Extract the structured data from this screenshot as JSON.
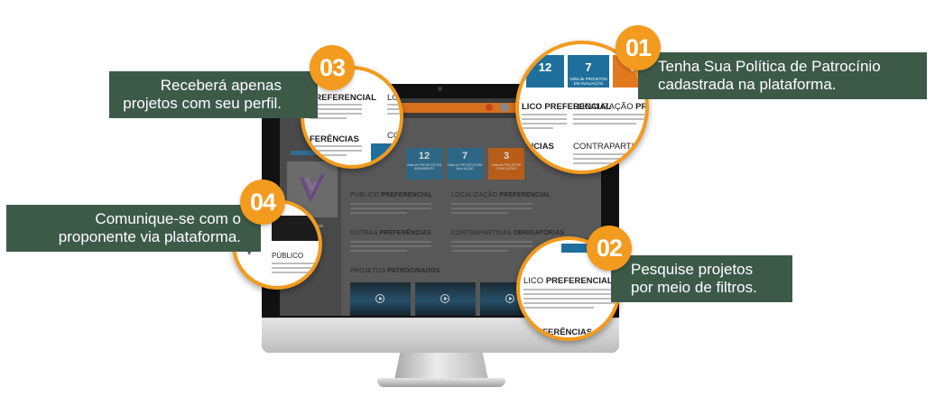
{
  "callouts": {
    "c01": {
      "number": "01",
      "line1": "Tenha Sua Política de Patrocínio",
      "line2": "cadastrada na plataforma."
    },
    "c02": {
      "number": "02",
      "line1": "Pesquise projetos",
      "line2": "por meio de filtros."
    },
    "c03": {
      "number": "03",
      "line1": "Receberá apenas",
      "line2": "projetos com seu perfil."
    },
    "c04": {
      "number": "04",
      "line1": "Comunique-se com o",
      "line2": "proponente via plataforma."
    }
  },
  "screen": {
    "stats": [
      {
        "value": "12",
        "label": "Volta de PROJETOS EM ANDAMENTO"
      },
      {
        "value": "7",
        "label": "Volta de PROJETOS EM AVALIAÇÃO"
      },
      {
        "value": "3",
        "label": "Volta de PROJETOS CONCLUÍDOS"
      }
    ],
    "sections": {
      "publico": {
        "light": "PÚBLICO ",
        "bold": "PREFERENCIAL"
      },
      "localizacao": {
        "light": "LOCALIZAÇÃO ",
        "bold": "PREFERENCIAL"
      },
      "outras": {
        "light": "OUTRAS ",
        "bold": "PREFERÊNCIAS"
      },
      "contrapartidas": {
        "light": "CONTRAPARTIDAS ",
        "bold": "OBRIGATÓRIAS"
      },
      "projetos": {
        "light": "PROJETOS ",
        "bold": "PATROCINADOS"
      }
    }
  },
  "zoom": {
    "c01": {
      "stats": [
        "12",
        "7",
        "3"
      ],
      "stat_label": "Volta de PROJETOS EM AVALIAÇÃO",
      "h1": "LICO PREFERENCIAL",
      "h2a": "LOCALIZAÇÃO ",
      "h2b": "PREFERENCI",
      "h3": "ÊNCIAS",
      "h4a": "CONTRAPARTIDAS ",
      "h4b": "O"
    },
    "c02": {
      "h1a": "LICO ",
      "h1b": "PREFERENCIAL",
      "h2": "REFERÊNCIAS"
    },
    "c03": {
      "h1": "PREFERENCIAL",
      "h2": "FERÊNCIAS",
      "side1": "LO",
      "side2": "CO"
    },
    "c04": {
      "label": "PÚBLICO"
    }
  },
  "colors": {
    "accent": "#f29b1e",
    "callout_bg": "#3d5a49",
    "stat_blue": "#1f6f9c",
    "stat_orange": "#e3791f"
  }
}
